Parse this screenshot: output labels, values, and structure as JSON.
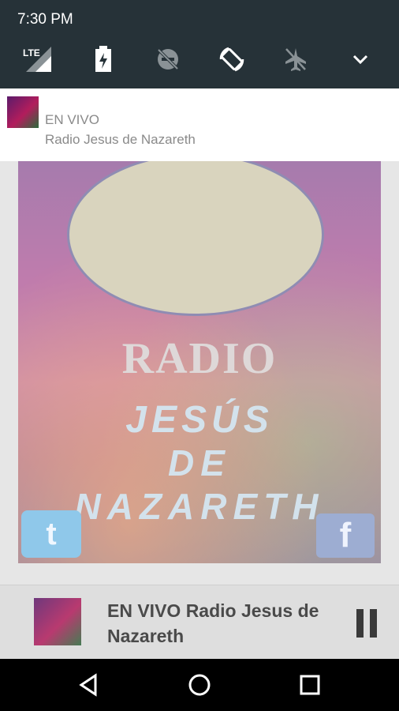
{
  "status_bar": {
    "time": "7:30 PM"
  },
  "quick_settings": {
    "icons": [
      "lte-signal-icon",
      "battery-charging-icon",
      "do-not-disturb-off-icon",
      "auto-rotate-icon",
      "airplane-mode-icon",
      "expand-icon"
    ],
    "lte_label": "LTE"
  },
  "notification": {
    "title": "EN VIVO",
    "text": "Radio Jesus de Nazareth"
  },
  "cover_art": {
    "line1": "RADIO",
    "line2": "JESÚS",
    "line3": "DE",
    "line4": "NAZARETH",
    "twitter_glyph": "t",
    "facebook_glyph": "f"
  },
  "player": {
    "title": "EN VIVO Radio Jesus de Nazareth",
    "control_icon": "pause-icon"
  },
  "nav_bar": {
    "buttons": [
      "back-icon",
      "home-icon",
      "recents-icon"
    ]
  },
  "colors": {
    "shade_bg": "#263238",
    "nav_bg": "#000000"
  }
}
